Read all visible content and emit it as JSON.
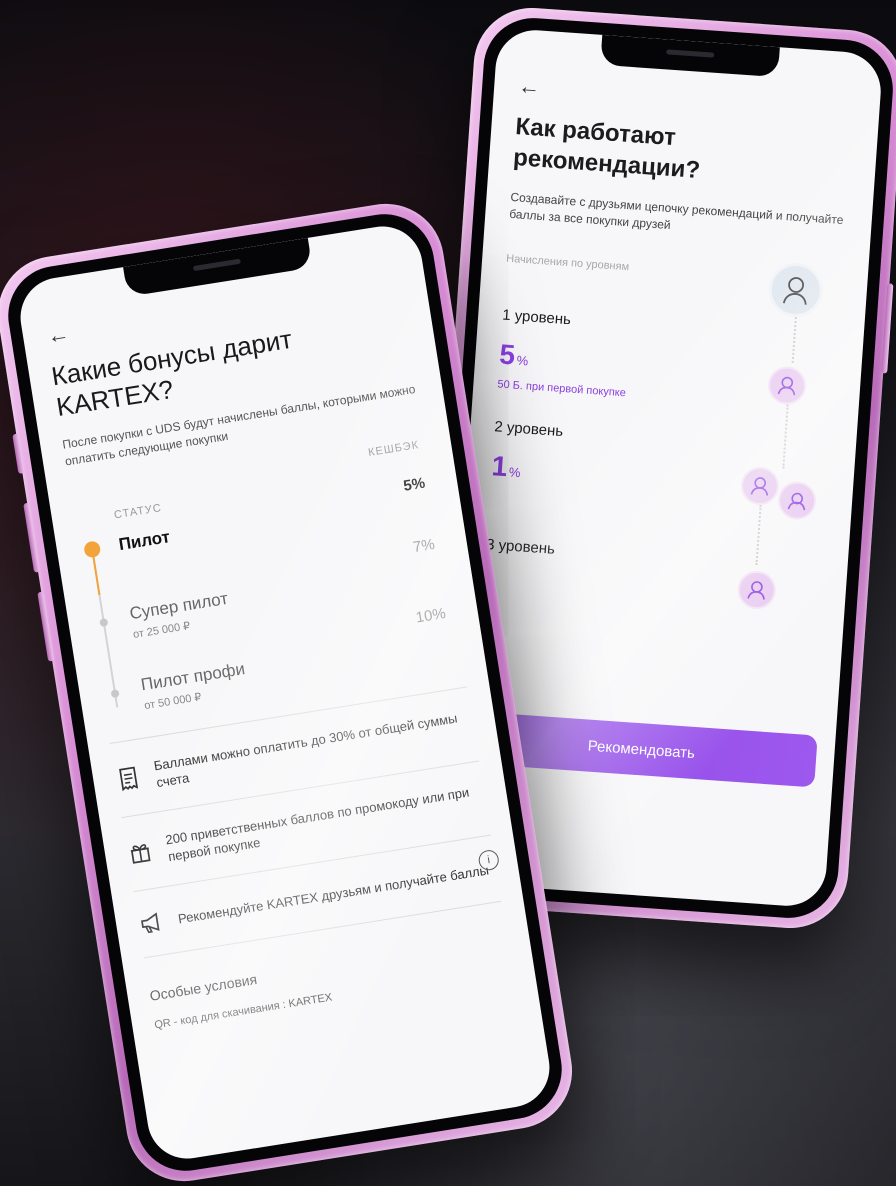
{
  "left": {
    "back": "←",
    "title": "Какие бонусы дарит KARTEX?",
    "subtitle": "После покупки с UDS будут начислены баллы, которыми можно оплатить следующие покупки",
    "col_status": "Статус",
    "col_cashback": "Кешбэк",
    "levels": [
      {
        "name": "Пилот",
        "min": "",
        "pct": "5%"
      },
      {
        "name": "Супер пилот",
        "min": "от 25 000 ₽",
        "pct": "7%"
      },
      {
        "name": "Пилот профи",
        "min": "от 50 000 ₽",
        "pct": "10%"
      }
    ],
    "features": [
      {
        "text": "Баллами можно оплатить до 30% от общей суммы счета",
        "icon": "receipt-icon"
      },
      {
        "text": "200 приветственных баллов по промокоду или при первой покупке",
        "icon": "gift-icon"
      },
      {
        "text": "Рекомендуйте KARTEX друзьям и получайте баллы",
        "icon": "megaphone-icon"
      }
    ],
    "info": "i",
    "conditions_title": "Особые условия",
    "qr_text": "QR - код для скачивания : KARTEX"
  },
  "right": {
    "back": "←",
    "title": "Как работают рекомендации?",
    "subtitle": "Создавайте с друзьями цепочку рекомендаций и получайте баллы за все покупки друзей",
    "accrual_label": "Начисления по уровням",
    "level1": {
      "label": "1 уровень",
      "pct": "5",
      "unit": "%",
      "note": "50 Б. при первой покупке"
    },
    "level2": {
      "label": "2 уровень",
      "pct": "1",
      "unit": "%"
    },
    "level3": {
      "label": "3 уровень"
    },
    "button": "Рекомендовать",
    "accent": "#8a3fe0"
  }
}
